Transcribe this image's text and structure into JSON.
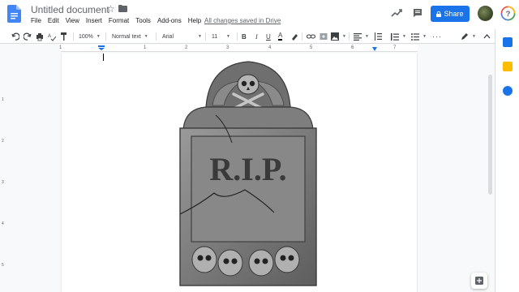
{
  "header": {
    "title": "Untitled document",
    "menu": [
      "File",
      "Edit",
      "View",
      "Insert",
      "Format",
      "Tools",
      "Add-ons",
      "Help"
    ],
    "saved_status": "All changes saved in Drive",
    "share_label": "Share"
  },
  "toolbar": {
    "zoom": "100%",
    "style": "Normal text",
    "font": "Arial",
    "font_size": "11"
  },
  "ruler": {
    "numbers": [
      "1",
      "1",
      "2",
      "3",
      "4",
      "5",
      "6",
      "7"
    ]
  },
  "vruler": {
    "numbers": [
      "1",
      "2",
      "3",
      "4",
      "5"
    ]
  },
  "image": {
    "engraving": "R.I.P."
  },
  "colors": {
    "accent": "#1a73e8",
    "doc_blue": "#4285f4"
  }
}
